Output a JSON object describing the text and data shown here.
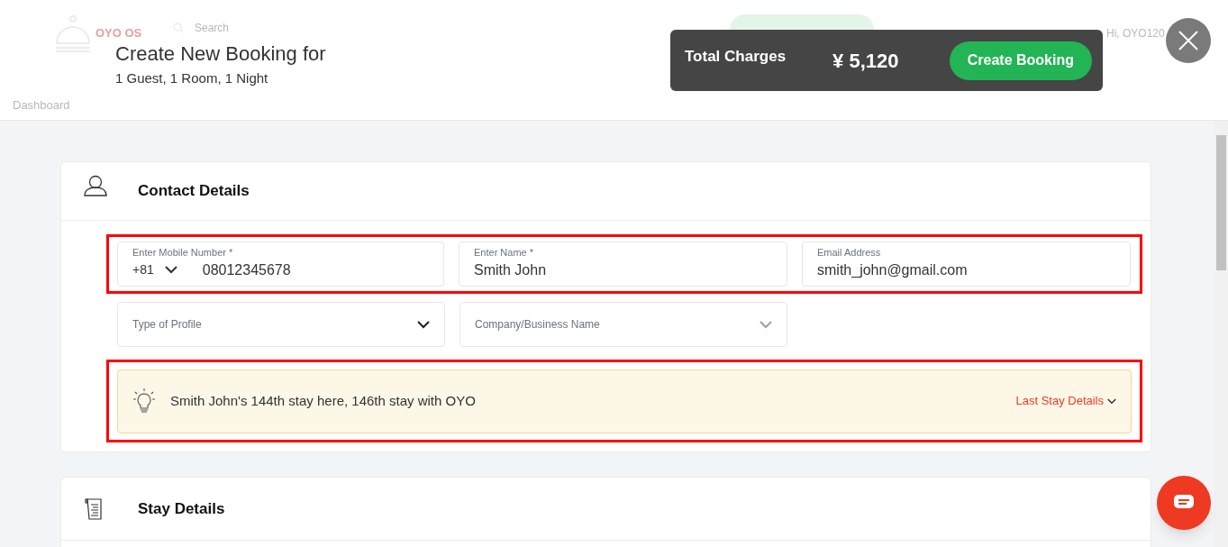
{
  "background_header": {
    "logo": "OYO OS",
    "search": "Search",
    "greeting": "Hi, OYO120",
    "nav": "Dashboard"
  },
  "modal": {
    "title": "Create New Booking for",
    "subtitle": "1 Guest, 1 Room, 1 Night"
  },
  "charges_bar": {
    "label": "Total Charges",
    "amount": "¥ 5,120",
    "button": "Create Booking"
  },
  "contact": {
    "title": "Contact Details",
    "fields": [
      {
        "kind": "phone",
        "label": "Enter Mobile Number *",
        "code": "+81",
        "value": "08012345678"
      },
      {
        "kind": "text",
        "label": "Enter Name *",
        "value": "Smith John"
      },
      {
        "kind": "text",
        "label": "Email Address",
        "value": "smith_john@gmail.com"
      },
      {
        "kind": "select",
        "placeholder": "Type of Profile"
      },
      {
        "kind": "select",
        "placeholder": "Company/Business Name",
        "disabled": true
      }
    ],
    "banner": {
      "text": "Smith John's 144th stay here, 146th stay with OYO",
      "link": "Last Stay Details"
    }
  },
  "stay": {
    "title": "Stay Details"
  }
}
